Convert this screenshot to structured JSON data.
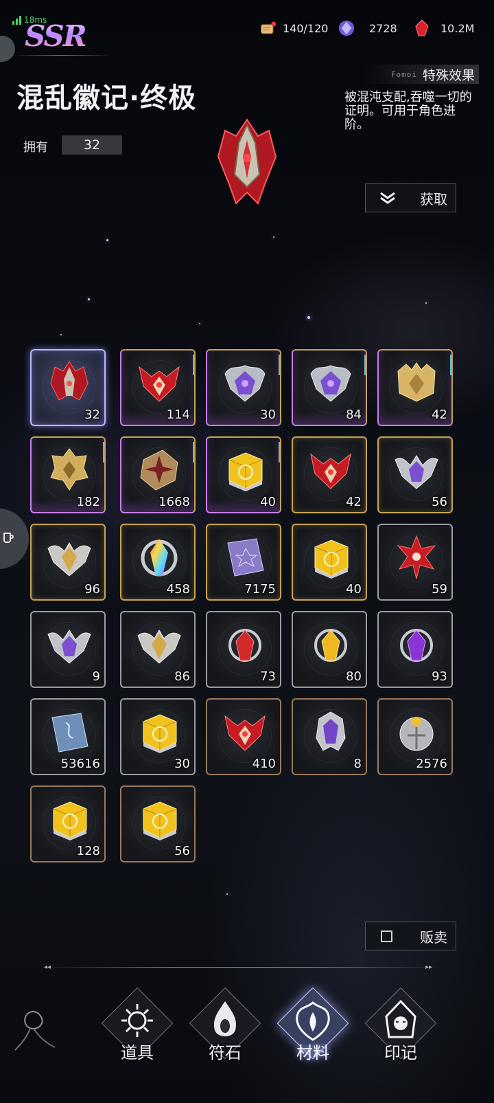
{
  "status": {
    "ping": "18ms",
    "rarity": "SSR"
  },
  "resources": [
    {
      "name": "stamina",
      "icon": "scroll-icon",
      "value": "140/120"
    },
    {
      "name": "crystal",
      "icon": "purple-crystal-icon",
      "value": "2728"
    },
    {
      "name": "ruby",
      "icon": "red-gem-icon",
      "value": "10.2M"
    }
  ],
  "item": {
    "name": "混乱徽记·终极",
    "owned_label": "拥有",
    "owned_count": "32",
    "effect_tag": "Fomoi",
    "effect_title": "特殊效果",
    "effect_desc": "被混沌支配,吞噬一切的证明。可用于角色进阶。"
  },
  "actions": {
    "get_label": "获取",
    "sell_label": "贩卖"
  },
  "colors": {
    "gold": "#c9a24e",
    "purple": "#c97ce8",
    "silver": "#9a9ca2",
    "bronze": "#9c7a5a",
    "selected": "#b8b6ff"
  },
  "grid": [
    {
      "count": "32",
      "frame": "selected",
      "icon": "red-chaos-emblem"
    },
    {
      "count": "114",
      "frame": "purple",
      "icon": "red-horned-crest"
    },
    {
      "count": "30",
      "frame": "purple",
      "icon": "purple-silver-emblem"
    },
    {
      "count": "84",
      "frame": "purple",
      "icon": "purple-silver-emblem"
    },
    {
      "count": "42",
      "frame": "purple",
      "icon": "gold-crown-emblem"
    },
    {
      "count": "182",
      "frame": "purple",
      "icon": "gold-spiked-emblem"
    },
    {
      "count": "1668",
      "frame": "purple",
      "icon": "bronze-cross-block"
    },
    {
      "count": "40",
      "frame": "purple",
      "icon": "gold-cube"
    },
    {
      "count": "42",
      "frame": "gold",
      "icon": "red-horned-crest"
    },
    {
      "count": "56",
      "frame": "gold",
      "icon": "purple-winged-emblem"
    },
    {
      "count": "96",
      "frame": "gold",
      "icon": "gold-winged-emblem"
    },
    {
      "count": "458",
      "frame": "gold",
      "icon": "rainbow-crystal"
    },
    {
      "count": "7175",
      "frame": "gold",
      "icon": "purple-tome"
    },
    {
      "count": "40",
      "frame": "gold",
      "icon": "gold-cube"
    },
    {
      "count": "59",
      "frame": "silver",
      "icon": "red-star-emblem"
    },
    {
      "count": "9",
      "frame": "silver",
      "icon": "purple-winged-emblem"
    },
    {
      "count": "86",
      "frame": "silver",
      "icon": "gold-winged-emblem"
    },
    {
      "count": "73",
      "frame": "silver",
      "icon": "red-crystal"
    },
    {
      "count": "80",
      "frame": "silver",
      "icon": "gold-crystal"
    },
    {
      "count": "93",
      "frame": "silver",
      "icon": "purple-crystal"
    },
    {
      "count": "53616",
      "frame": "silver",
      "icon": "blue-tome"
    },
    {
      "count": "30",
      "frame": "silver",
      "icon": "gold-cube"
    },
    {
      "count": "410",
      "frame": "bronze",
      "icon": "red-horned-crest"
    },
    {
      "count": "8",
      "frame": "bronze",
      "icon": "purple-helm"
    },
    {
      "count": "2576",
      "frame": "bronze",
      "icon": "silver-orb-shield"
    },
    {
      "count": "128",
      "frame": "bronze",
      "icon": "gold-cube"
    },
    {
      "count": "56",
      "frame": "bronze",
      "icon": "gold-cube"
    }
  ],
  "tabs": [
    {
      "label": "道具",
      "icon": "sun-sigil-icon",
      "active": false
    },
    {
      "label": "符石",
      "icon": "flame-eye-icon",
      "active": false
    },
    {
      "label": "材料",
      "icon": "ornate-crest-icon",
      "active": true
    },
    {
      "label": "印记",
      "icon": "hooded-girl-icon",
      "active": false
    }
  ]
}
